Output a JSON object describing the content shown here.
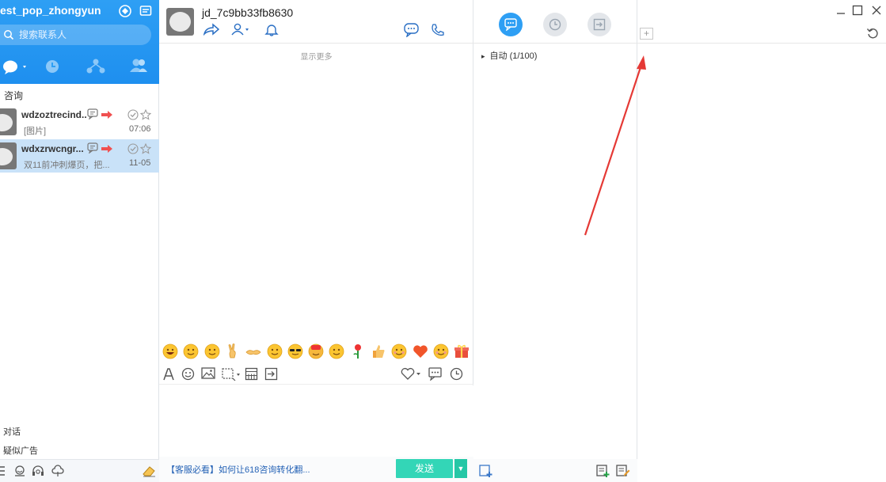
{
  "account": {
    "name": "est_pop_zhongyun"
  },
  "search": {
    "placeholder": "搜索联系人"
  },
  "contact_list": {
    "section_title": "咨询",
    "items": [
      {
        "name": "wdzoztrecind..",
        "message": "[图片]",
        "time": "07:06",
        "active": false
      },
      {
        "name": "wdxzrwcngr...",
        "message": "双11前冲刺爆页，把...",
        "time": "11-05",
        "active": true
      }
    ],
    "section_dialog": "对话",
    "section_ads": "疑似广告"
  },
  "chat": {
    "username": "jd_7c9bb33fb8630",
    "show_more": "显示更多",
    "promo_link": "【客服必看】如何让618咨询转化翻...",
    "send_label": "发送",
    "send_dropdown": "▼"
  },
  "quick_reply": {
    "group_label": "自动 (1/100)",
    "group_toggle": "▸"
  },
  "right_panel": {
    "add_tab": "+"
  },
  "colors": {
    "brand_blue": "#2e9ff4",
    "send_green": "#33d6b7",
    "highlight_row": "#c9e2f8",
    "annotation_red": "#e53935",
    "notify_red": "#f05050"
  },
  "emojis": [
    "grin",
    "sleepy",
    "blush",
    "victory",
    "handshake",
    "thinking",
    "cool",
    "rich",
    "smile",
    "rose",
    "thumbs-up",
    "kiss",
    "heart",
    "shy",
    "gift"
  ]
}
